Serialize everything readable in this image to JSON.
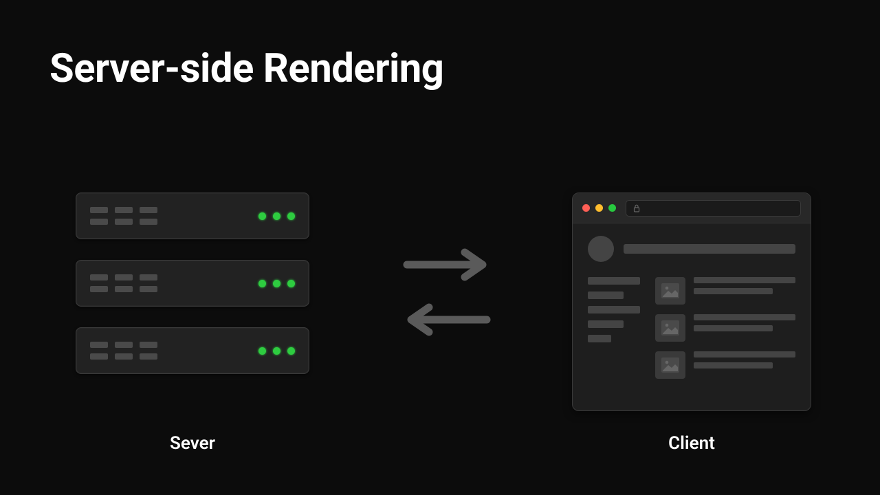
{
  "title": "Server-side Rendering",
  "labels": {
    "server": "Sever",
    "client": "Client"
  },
  "icons": {
    "arrow_right": "arrow-right-icon",
    "arrow_left": "arrow-left-icon",
    "lock": "lock-icon",
    "image_placeholder": "image-placeholder-icon",
    "traffic_red": "close-icon",
    "traffic_yellow": "minimize-icon",
    "traffic_green": "maximize-icon",
    "led": "status-led-icon"
  },
  "colors": {
    "bg": "#0c0c0c",
    "led_green": "#2ecc40",
    "traffic_red": "#ff5f56",
    "traffic_yellow": "#ffbd2e",
    "traffic_green": "#27c93f",
    "placeholder": "#444",
    "arrow": "#5a5a5a"
  },
  "server": {
    "units": 3,
    "leds_per_unit": 3,
    "bay_columns": 3,
    "bays_per_column": 2
  },
  "browser": {
    "feed_items": 3
  }
}
